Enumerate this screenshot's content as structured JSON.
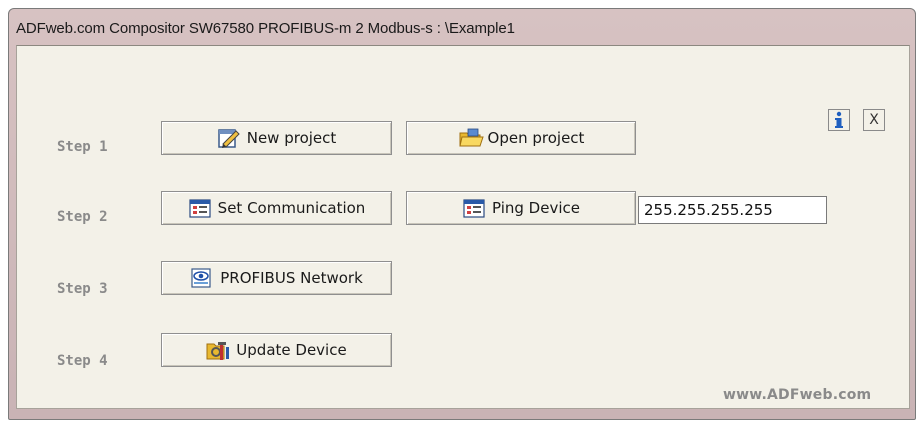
{
  "window": {
    "title": "ADFweb.com Compositor SW67580 PROFIBUS-m 2 Modbus-s : \\Example1"
  },
  "steps": [
    {
      "label": "Step 1"
    },
    {
      "label": "Step 2"
    },
    {
      "label": "Step 3"
    },
    {
      "label": "Step 4"
    }
  ],
  "buttons": {
    "new_project": {
      "label": "New project",
      "icon": "new-project-icon"
    },
    "open_project": {
      "label": "Open project",
      "icon": "folder-icon"
    },
    "set_communication": {
      "label": "Set Communication",
      "icon": "settings-window-icon"
    },
    "ping_device": {
      "label": "Ping Device",
      "icon": "ping-window-icon"
    },
    "profibus_network": {
      "label": "PROFIBUS Network",
      "icon": "network-eye-icon"
    },
    "update_device": {
      "label": "Update Device",
      "icon": "update-tools-icon"
    }
  },
  "ping": {
    "ip_value": "255.255.255.255"
  },
  "corner": {
    "info_icon": "info-icon",
    "close_label": "X"
  },
  "footer": {
    "website": "www.ADFweb.com"
  },
  "colors": {
    "client_bg": "#f3f1e8",
    "title_bar": "#d7c2c2",
    "step_text": "#8a8a8a",
    "info_blue": "#1f5fbf"
  }
}
